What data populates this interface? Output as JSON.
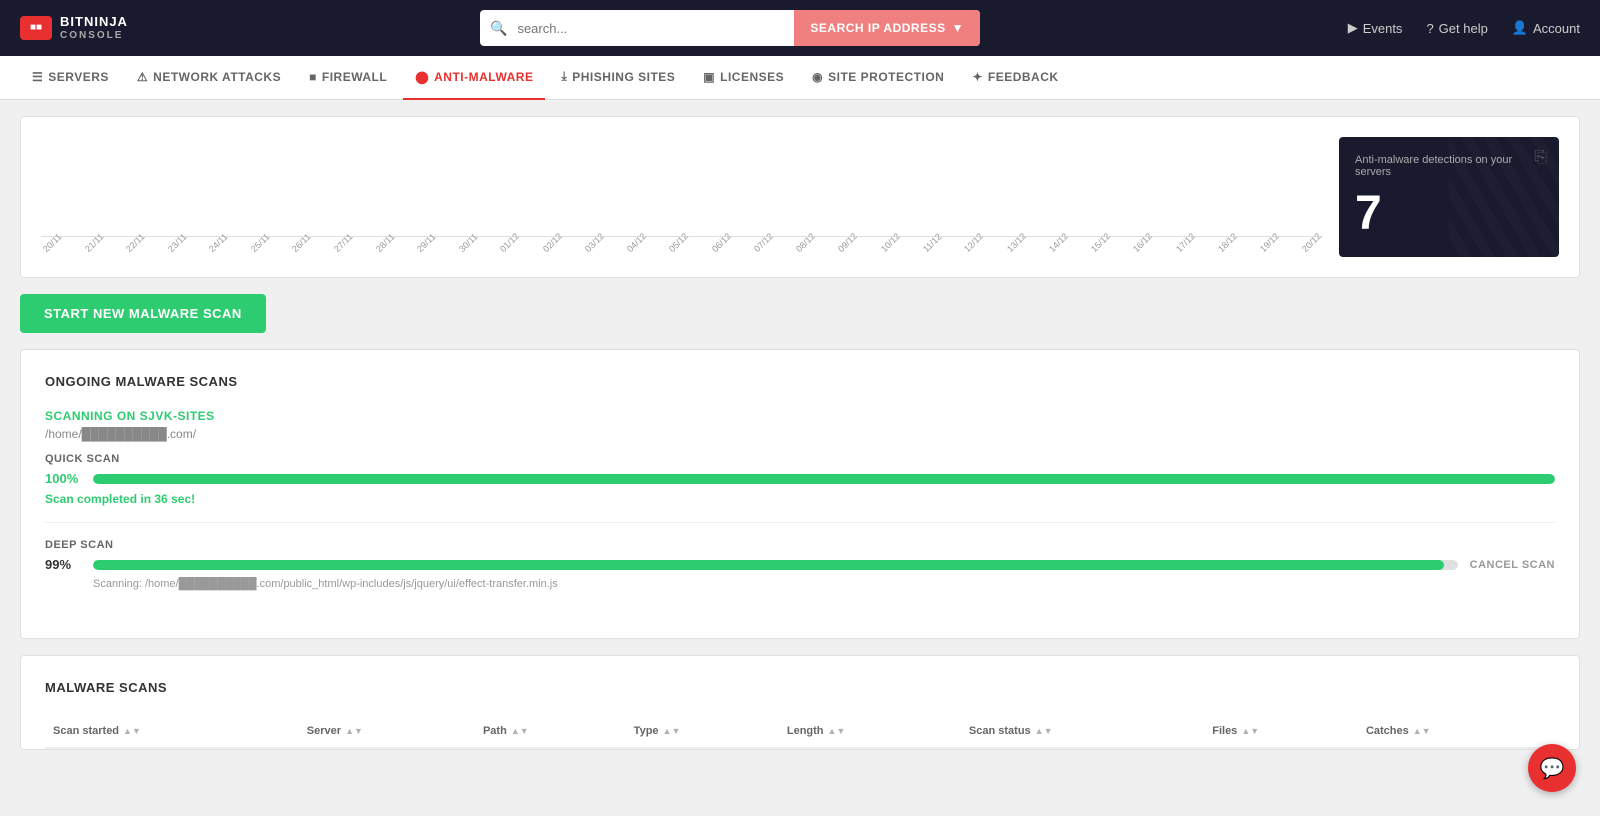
{
  "header": {
    "logo_top": "BITNINJA",
    "logo_bottom": "CONSOLE",
    "search_placeholder": "search...",
    "search_ip_label": "SEARCH IP ADDRESS",
    "nav_events": "Events",
    "nav_help": "Get help",
    "nav_account": "Account"
  },
  "nav": {
    "items": [
      {
        "id": "servers",
        "label": "SERVERS",
        "active": false
      },
      {
        "id": "network-attacks",
        "label": "NETWORK ATTACKS",
        "active": false
      },
      {
        "id": "firewall",
        "label": "FIREWALL",
        "active": false
      },
      {
        "id": "anti-malware",
        "label": "ANTI-MALWARE",
        "active": true
      },
      {
        "id": "phishing-sites",
        "label": "PHISHING SITES",
        "active": false
      },
      {
        "id": "licenses",
        "label": "LICENSES",
        "active": false
      },
      {
        "id": "site-protection",
        "label": "SITE PROTECTION",
        "active": false
      },
      {
        "id": "feedback",
        "label": "FEEDBACK",
        "active": false
      }
    ]
  },
  "chart": {
    "dates": [
      "20/11",
      "21/11",
      "22/11",
      "23/11",
      "24/11",
      "25/11",
      "26/11",
      "27/11",
      "28/11",
      "29/11",
      "30/11",
      "01/12",
      "02/12",
      "03/12",
      "04/12",
      "05/12",
      "06/12",
      "07/12",
      "08/12",
      "09/12",
      "10/12",
      "11/12",
      "12/12",
      "13/12",
      "14/12",
      "15/12",
      "16/12",
      "17/12",
      "18/12",
      "19/12",
      "20/12"
    ],
    "side_card": {
      "title": "Anti-malware detections on your servers",
      "number": "7"
    }
  },
  "actions": {
    "start_scan_label": "START NEW MALWARE SCAN"
  },
  "ongoing_scans": {
    "section_title": "ONGOING MALWARE SCANS",
    "scan": {
      "server_label": "SCANNING ON SJVK-SITES",
      "path": "/home/██████████.com/",
      "quick_scan": {
        "label": "QUICK SCAN",
        "percent": "100%",
        "fill_width": "100",
        "complete_msg": "Scan completed in 36 sec!"
      },
      "deep_scan": {
        "label": "DEEP SCAN",
        "percent": "99%",
        "fill_width": "99",
        "cancel_label": "CANCEL SCAN",
        "current_file": "Scanning: /home/██████████.com/public_html/wp-includes/js/jquery/ui/effect-transfer.min.js"
      }
    }
  },
  "malware_scans": {
    "section_title": "MALWARE SCANS",
    "columns": [
      {
        "id": "scan-started",
        "label": "Scan started"
      },
      {
        "id": "server",
        "label": "Server"
      },
      {
        "id": "path",
        "label": "Path"
      },
      {
        "id": "type",
        "label": "Type"
      },
      {
        "id": "length",
        "label": "Length"
      },
      {
        "id": "scan-status",
        "label": "Scan status"
      },
      {
        "id": "files",
        "label": "Files"
      },
      {
        "id": "catches",
        "label": "Catches"
      }
    ]
  },
  "colors": {
    "green": "#2ecc71",
    "red": "#e83030",
    "dark_bg": "#1a1a2e",
    "salmon": "#f08080"
  }
}
